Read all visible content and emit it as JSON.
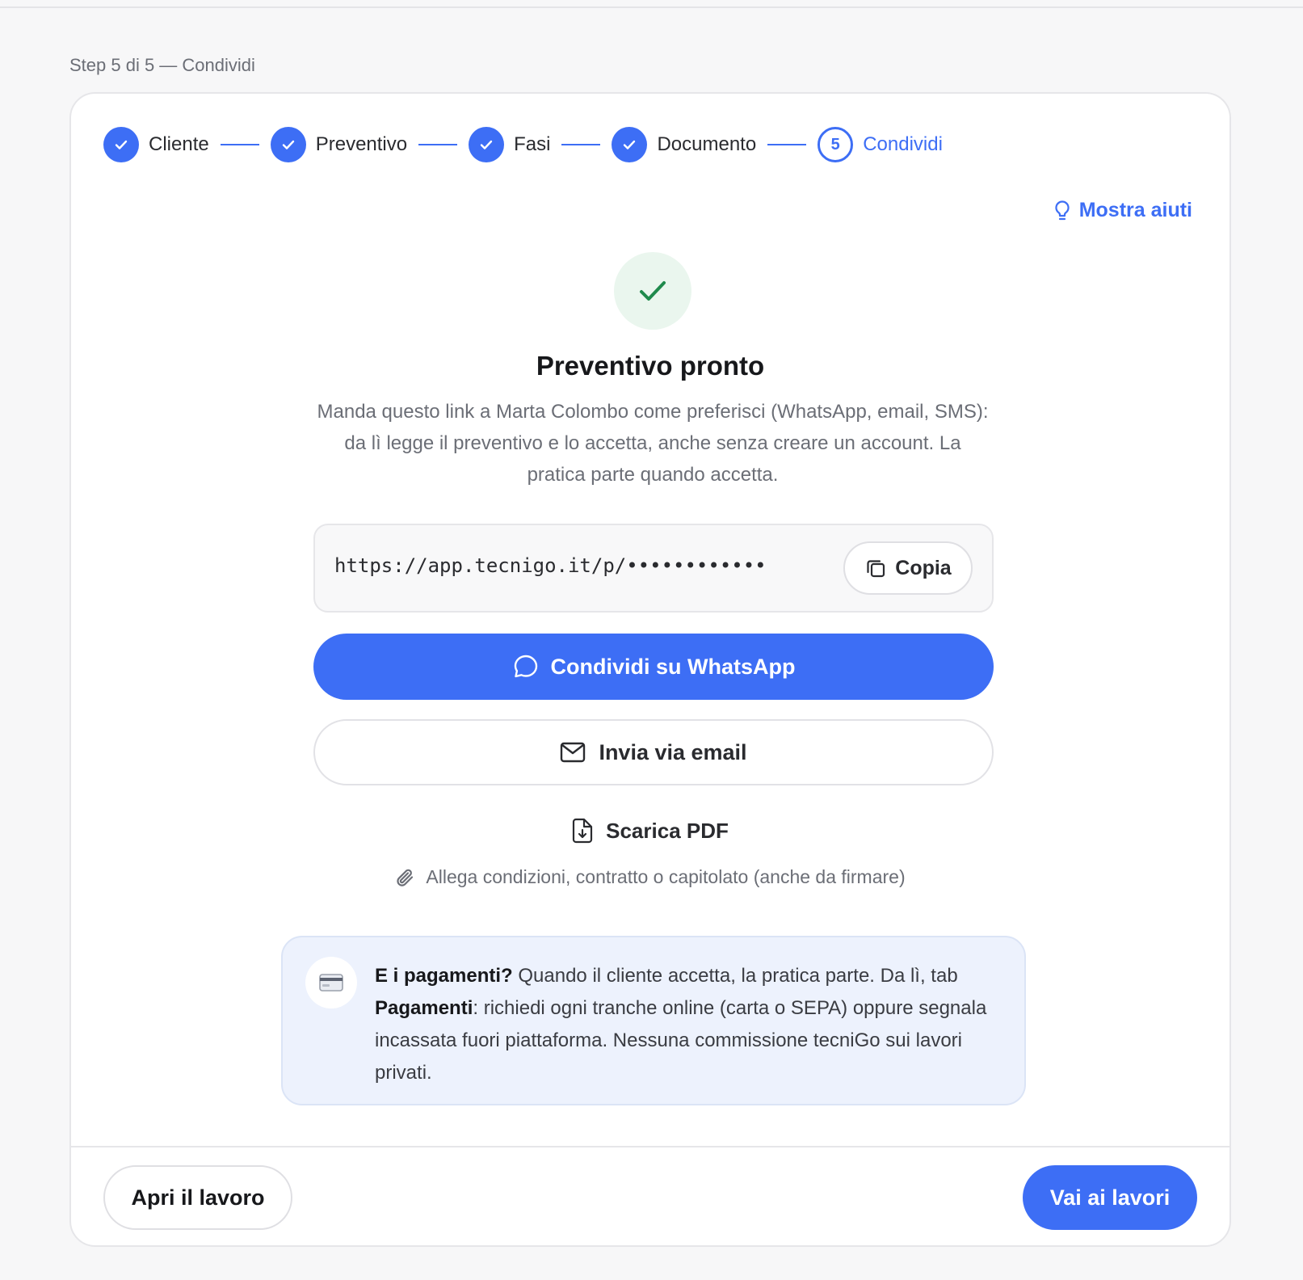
{
  "page": {
    "step_caption": "Step 5 di 5 — Condividi"
  },
  "stepper": {
    "steps": [
      {
        "label": "Cliente",
        "status": "done"
      },
      {
        "label": "Preventivo",
        "status": "done"
      },
      {
        "label": "Fasi",
        "status": "done"
      },
      {
        "label": "Documento",
        "status": "done"
      },
      {
        "label": "Condividi",
        "status": "current",
        "number": "5"
      }
    ]
  },
  "help": {
    "label": "Mostra aiuti",
    "icon": "lightbulb-icon"
  },
  "success": {
    "icon": "check-icon",
    "title": "Preventivo pronto",
    "description": "Manda questo link a Marta Colombo come preferisci (WhatsApp, email, SMS): da lì legge il preventivo e lo accetta, anche senza creare un account. La pratica parte quando accetta."
  },
  "share_link": {
    "url": "https://app.tecnigo.it/p/••••••••••••",
    "copy_label": "Copia"
  },
  "actions": {
    "whatsapp_label": "Condividi su WhatsApp",
    "email_label": "Invia via email",
    "pdf_label": "Scarica PDF",
    "attach_label": "Allega condizioni, contratto o capitolato (anche da firmare)"
  },
  "payments_info": {
    "icon": "credit-card-icon",
    "heading": "E i pagamenti?",
    "text_1": " Quando il cliente accetta, la pratica parte. Da lì, tab ",
    "tab_name": "Pagamenti",
    "text_2": ": richiedi ogni tranche online (carta o SEPA) oppure segnala incassata fuori piattaforma. Nessuna commissione tecniGo sui lavori privati."
  },
  "footer": {
    "open_job_label": "Apri il lavoro",
    "jobs_label": "Vai ai lavori"
  },
  "colors": {
    "accent": "#3d6ef5",
    "success": "#1f8a4c",
    "info_bg": "#edf2fd"
  }
}
